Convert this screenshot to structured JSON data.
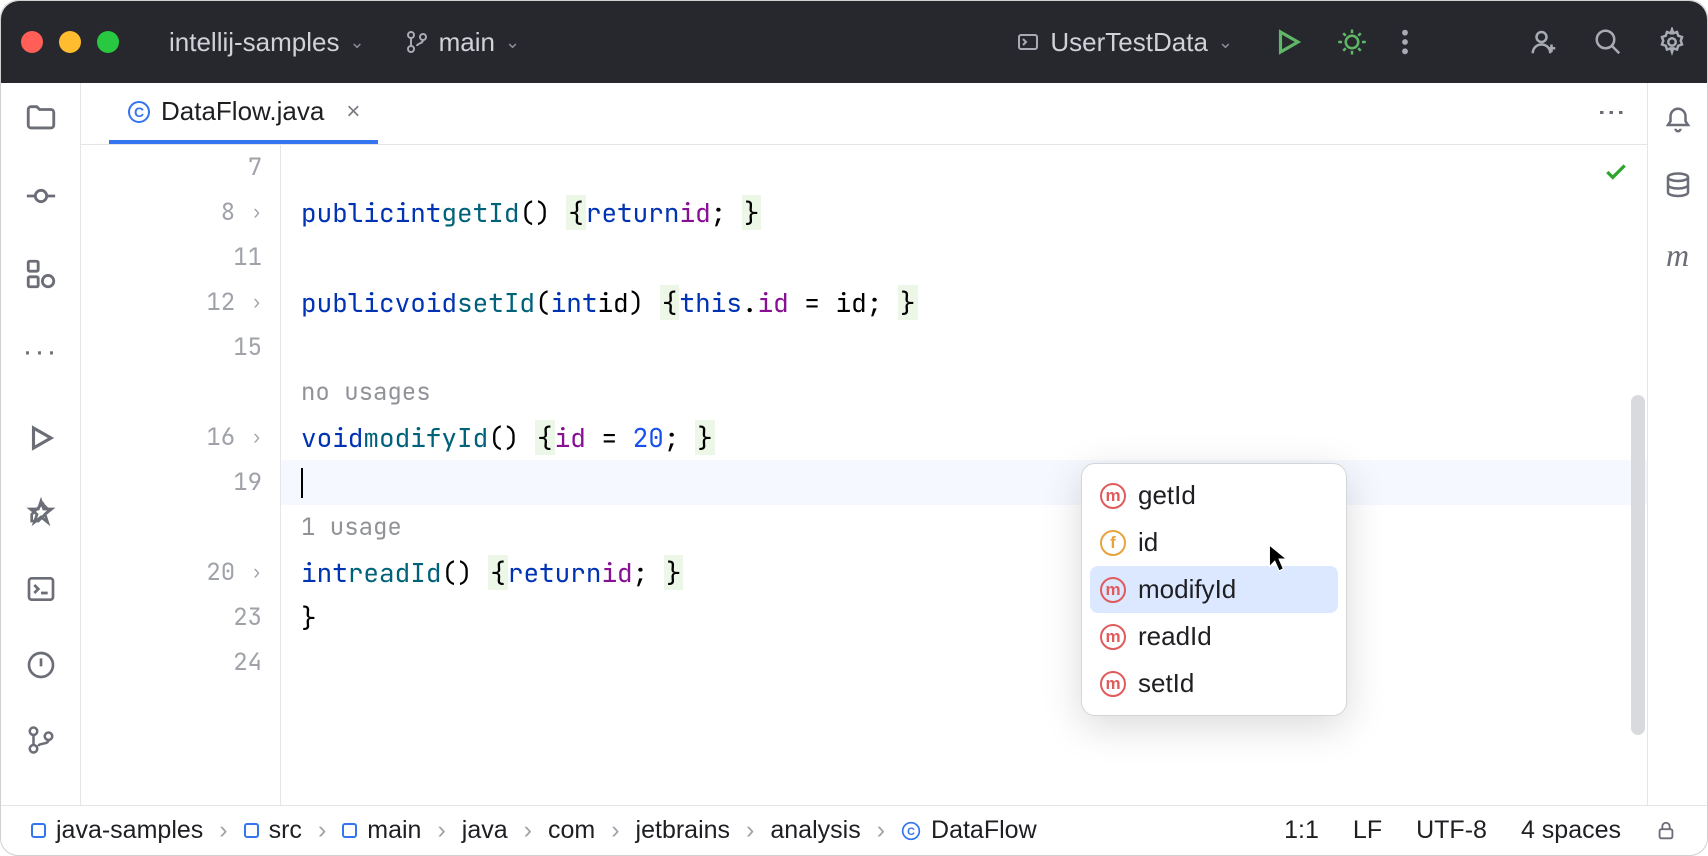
{
  "title_bar": {
    "project_name": "intellij-samples",
    "branch": "main",
    "run_config": "UserTestData"
  },
  "tab": {
    "filename": "DataFlow.java"
  },
  "gutter_lines": [
    "7",
    "8",
    "11",
    "12",
    "15",
    "",
    "16",
    "19",
    "",
    "20",
    "23",
    "24"
  ],
  "gutter_fold": {
    "1": "›",
    "3": "›",
    "6": "›",
    "9": "›"
  },
  "code": {
    "l8_public": "public",
    "l8_int": "int",
    "l8_getId": "getId",
    "l8_return": "return",
    "l8_id": "id",
    "l12_public": "public",
    "l12_void": "void",
    "l12_setId": "setId",
    "l12_int": "int",
    "l12_idp": "id",
    "l12_this": "this",
    "l12_id": "id",
    "l12_idr": "id",
    "hint_nousages": "no usages",
    "l16_void": "void",
    "l16_modifyId": "modifyId",
    "l16_id": "id",
    "l16_20": "20",
    "hint_1usage": "1 usage",
    "l20_int": "int",
    "l20_readId": "readId",
    "l20_return": "return",
    "l20_id": "id",
    "l23_brace": "}"
  },
  "popup": {
    "items": [
      {
        "icon": "m",
        "label": "getId",
        "sel": false
      },
      {
        "icon": "f",
        "label": "id",
        "sel": false
      },
      {
        "icon": "m",
        "label": "modifyId",
        "sel": true
      },
      {
        "icon": "m",
        "label": "readId",
        "sel": false
      },
      {
        "icon": "m",
        "label": "setId",
        "sel": false
      }
    ]
  },
  "breadcrumbs": [
    "java-samples",
    "src",
    "main",
    "java",
    "com",
    "jetbrains",
    "analysis",
    "DataFlow"
  ],
  "status": {
    "pos": "1:1",
    "eol": "LF",
    "enc": "UTF-8",
    "indent": "4 spaces"
  }
}
